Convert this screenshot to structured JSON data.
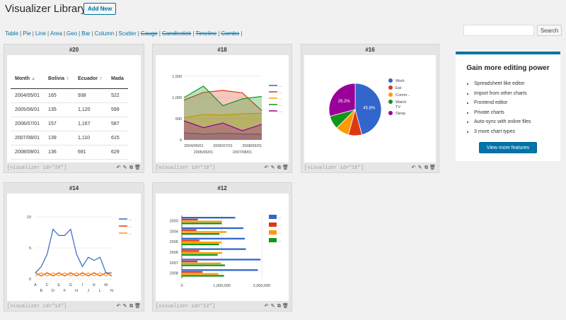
{
  "page": {
    "title": "Visualizer Library",
    "add_new": "Add New"
  },
  "filters": [
    {
      "label": "Table",
      "pro": false
    },
    {
      "label": "Pie",
      "pro": false
    },
    {
      "label": "Line",
      "pro": false
    },
    {
      "label": "Area",
      "pro": false
    },
    {
      "label": "Geo",
      "pro": false
    },
    {
      "label": "Bar",
      "pro": false
    },
    {
      "label": "Column",
      "pro": false
    },
    {
      "label": "Scatter",
      "pro": false
    },
    {
      "label": "Gauge",
      "pro": true
    },
    {
      "label": "Candlestick",
      "pro": true
    },
    {
      "label": "Timeline",
      "pro": true
    },
    {
      "label": "Combo",
      "pro": true
    }
  ],
  "search": {
    "button": "Search",
    "placeholder": ""
  },
  "cards": [
    {
      "id": "#20",
      "shortcode": "[visualizer id=\"20\"]"
    },
    {
      "id": "#18",
      "shortcode": "[visualizer id=\"18\"]"
    },
    {
      "id": "#16",
      "shortcode": "[visualizer id=\"16\"]"
    },
    {
      "id": "#14",
      "shortcode": "[visualizer id=\"14\"]"
    },
    {
      "id": "#12",
      "shortcode": "[visualizer id=\"12\"]"
    }
  ],
  "card_actions": [
    "↶",
    "✎",
    "⧉",
    "🗑"
  ],
  "card_action_icons": [
    "undo-icon",
    "edit-icon",
    "copy-icon",
    "trash-icon"
  ],
  "promo": {
    "title": "Gain more editing power",
    "features": [
      "Spreadsheet like editor",
      "Import from other charts",
      "Frontend editor",
      "Private charts",
      "Auto-sync with online files",
      "3 more chart types"
    ],
    "button": "View more features"
  },
  "chart_data": [
    {
      "type": "table",
      "columns": [
        "Month",
        "Bolivia",
        "Ecuador",
        "Mada"
      ],
      "rows": [
        [
          "2004/05/01",
          "165",
          "938",
          "522"
        ],
        [
          "2005/06/01",
          "135",
          "1,120",
          "599"
        ],
        [
          "2006/07/01",
          "157",
          "1,167",
          "587"
        ],
        [
          "2007/08/01",
          "139",
          "1,110",
          "615"
        ],
        [
          "2008/09/01",
          "136",
          "691",
          "629"
        ]
      ]
    },
    {
      "type": "area",
      "x": [
        "2004/05/01",
        "2005/06/01",
        "2006/07/01",
        "2007/08/01",
        "2008/09/01"
      ],
      "ylim": [
        0,
        1500
      ],
      "yticks": [
        0,
        500,
        1000,
        1500
      ],
      "ytick_labels": [
        "0",
        "500",
        "1,000",
        "1,500"
      ],
      "series": [
        {
          "name": "...",
          "color": "#3366cc",
          "values": [
            165,
            135,
            157,
            139,
            136
          ]
        },
        {
          "name": "...",
          "color": "#dc3912",
          "values": [
            938,
            1120,
            1167,
            1110,
            691
          ]
        },
        {
          "name": "...",
          "color": "#ff9900",
          "values": [
            522,
            599,
            587,
            615,
            629
          ]
        },
        {
          "name": "...",
          "color": "#109618",
          "values": [
            998,
            1268,
            807,
            968,
            1026
          ]
        },
        {
          "name": "...",
          "color": "#990099",
          "values": [
            450,
            288,
            397,
            215,
            366
          ]
        }
      ]
    },
    {
      "type": "pie",
      "slices": [
        {
          "label": "Work",
          "value": 11,
          "color": "#3366cc"
        },
        {
          "label": "Eat",
          "value": 2,
          "color": "#dc3912"
        },
        {
          "label": "Comm...",
          "value": 2,
          "color": "#ff9900"
        },
        {
          "label": "Watch TV",
          "value": 2,
          "color": "#109618"
        },
        {
          "label": "Sleep",
          "value": 7,
          "color": "#990099"
        }
      ],
      "slice_labels": [
        "45.8%",
        "29.2%"
      ]
    },
    {
      "type": "line",
      "categories": [
        "A",
        "B",
        "C",
        "D",
        "E",
        "F",
        "G",
        "H",
        "I",
        "J",
        "K",
        "L",
        "M",
        "N"
      ],
      "ylim": [
        0,
        10
      ],
      "yticks": [
        0,
        5,
        10
      ],
      "series": [
        {
          "name": "...",
          "color": "#3366cc",
          "values": [
            1,
            2,
            4,
            8,
            7,
            7,
            8,
            4,
            2,
            3.5,
            3,
            3.5,
            1,
            1
          ]
        },
        {
          "name": "...",
          "color": "#dc3912",
          "values": [
            1,
            0.5,
            1,
            0.5,
            1,
            0.5,
            1,
            0.5,
            1,
            0.5,
            1,
            0.5,
            1,
            0.5
          ]
        },
        {
          "name": "...",
          "color": "#ff9900",
          "values": [
            0.5,
            1,
            0.5,
            1,
            0.5,
            1,
            0.5,
            1,
            0.5,
            1,
            0.5,
            1,
            0.5,
            1
          ]
        }
      ]
    },
    {
      "type": "bar",
      "categories": [
        "2003",
        "2004",
        "2005",
        "2006",
        "2007",
        "2008"
      ],
      "xlim": [
        0,
        2000000
      ],
      "xticks": [
        0,
        1000000,
        2000000
      ],
      "xtick_labels": [
        "0",
        "1,000,000",
        "2,000,000"
      ],
      "series": [
        {
          "name": "...",
          "color": "#3366cc",
          "values": [
            1336060,
            1538156,
            1576579,
            1600652,
            1968113,
            1901067
          ]
        },
        {
          "name": "...",
          "color": "#dc3912",
          "values": [
            400361,
            366849,
            440514,
            434552,
            393032,
            517206
          ]
        },
        {
          "name": "...",
          "color": "#ff9900",
          "values": [
            1001582,
            1119450,
            993360,
            1004163,
            979198,
            916965
          ]
        },
        {
          "name": "...",
          "color": "#109618",
          "values": [
            997974,
            941795,
            930593,
            897127,
            1080887,
            1056036
          ]
        }
      ]
    }
  ]
}
